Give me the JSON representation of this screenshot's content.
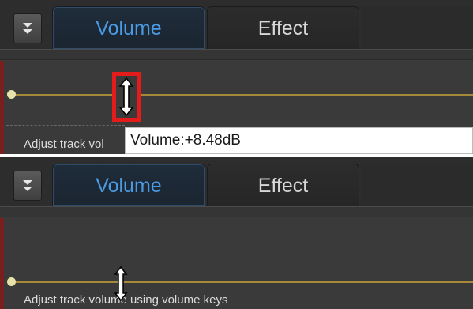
{
  "top_panel": {
    "tabs": {
      "volume_label": "Volume",
      "effect_label": "Effect"
    },
    "hint_text": "Adjust track vol",
    "tooltip_text": "Volume:+8.48dB"
  },
  "bottom_panel": {
    "tabs": {
      "volume_label": "Volume",
      "effect_label": "Effect"
    },
    "hint_text": "Adjust track volume using volume keys"
  },
  "colors": {
    "active_tab_text": "#4a9be4",
    "volume_line": "#a4893a",
    "highlight_box": "#e31b1b"
  },
  "icons": [
    "chevron-down-icon",
    "resize-vertical-cursor-icon",
    "volume-keyframe-dot"
  ]
}
